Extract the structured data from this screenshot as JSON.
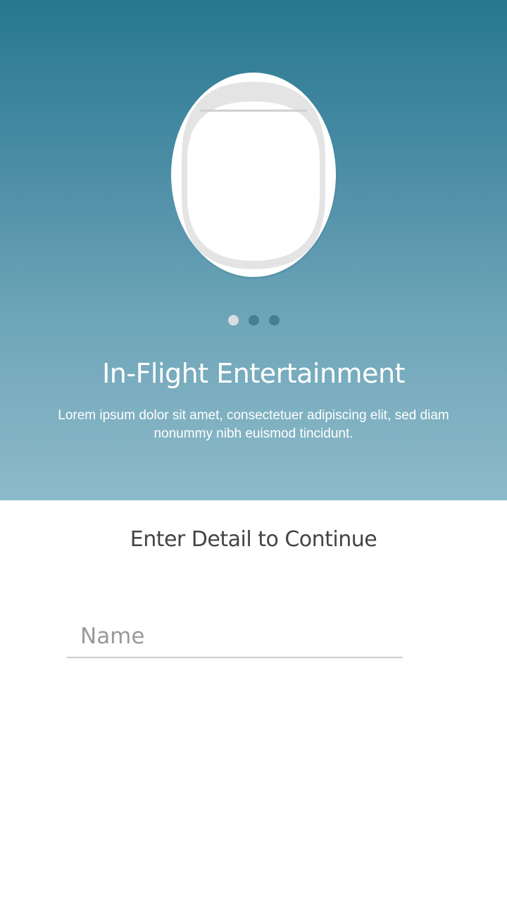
{
  "hero": {
    "illustration": "airplane-window-icon",
    "title": "In-Flight Entertainment",
    "description": "Lorem ipsum dolor sit amet, consectetuer adipiscing elit, sed diam nonummy nibh euismod tincidunt.",
    "pager": {
      "total": 3,
      "active": 1
    }
  },
  "form": {
    "title": "Enter Detail to Continue",
    "name_field": {
      "placeholder": "Name",
      "value": ""
    }
  },
  "colors": {
    "hero_gradient_top": "#26788f",
    "hero_gradient_bottom": "#8dbac9",
    "title_text": "#444444",
    "placeholder_text": "#9a9a9a"
  }
}
